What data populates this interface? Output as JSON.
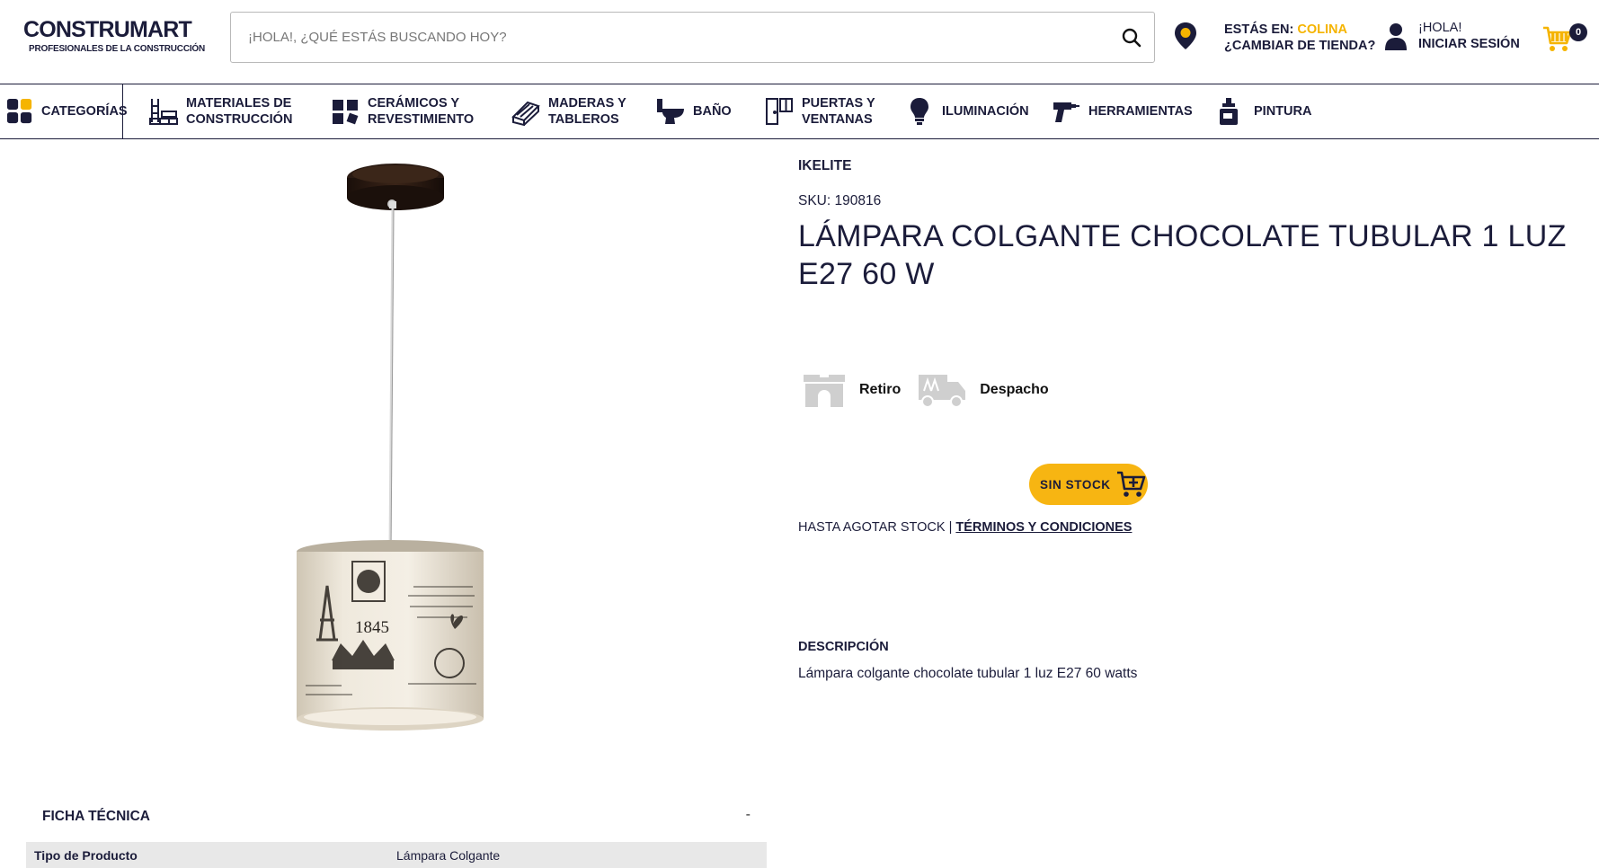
{
  "header": {
    "logo_text": "CONSTRUMART",
    "logo_tagline": "PROFESIONALES DE LA CONSTRUCCIÓN",
    "search_placeholder": "¡HOLA!, ¿QUÉ ESTÁS BUSCANDO HOY?",
    "store_prefix": "ESTÁS EN: ",
    "store_name": "COLINA",
    "store_change": "¿CAMBIAR DE TIENDA?",
    "greeting": "¡HOLA!",
    "login": "INICIAR SESIÓN",
    "cart_count": "0",
    "colors": {
      "navy": "#1b1c3a",
      "accent": "#f5b400"
    }
  },
  "nav": {
    "categories_label": "CATEGORÍAS",
    "items": [
      {
        "label": "MATERIALES DE\nCONSTRUCCIÓN",
        "icon": "bricks-icon"
      },
      {
        "label": "CERÁMICOS Y\nREVESTIMIENTO",
        "icon": "tiles-icon"
      },
      {
        "label": "MADERAS Y\nTABLEROS",
        "icon": "wood-icon"
      },
      {
        "label": "BAÑO",
        "icon": "toilet-icon"
      },
      {
        "label": "PUERTAS Y\nVENTANAS",
        "icon": "door-icon"
      },
      {
        "label": "ILUMINACIÓN",
        "icon": "bulb-icon"
      },
      {
        "label": "HERRAMIENTAS",
        "icon": "drill-icon"
      },
      {
        "label": "PINTURA",
        "icon": "paint-icon"
      }
    ]
  },
  "product": {
    "brand": "IKELITE",
    "sku": "SKU: 190816",
    "title": "LÁMPARA COLGANTE CHOCOLATE TUBULAR 1 LUZ E27 60 W",
    "delivery": [
      {
        "label": "Retiro",
        "icon": "store-pickup-icon"
      },
      {
        "label": "Despacho",
        "icon": "delivery-truck-icon"
      }
    ],
    "stock_button": "SIN STOCK",
    "terms_prefix": "HASTA AGOTAR STOCK | ",
    "terms_link": "TÉRMINOS Y CONDICIONES",
    "description_title": "DESCRIPCIÓN",
    "description_text": "Lámpara colgante chocolate tubular 1 luz E27 60 watts",
    "image_year": "1845"
  },
  "ficha": {
    "title": "FICHA TÉCNICA",
    "toggle": "-",
    "rows": [
      {
        "key": "Tipo de Producto",
        "value": "Lámpara Colgante"
      }
    ]
  }
}
